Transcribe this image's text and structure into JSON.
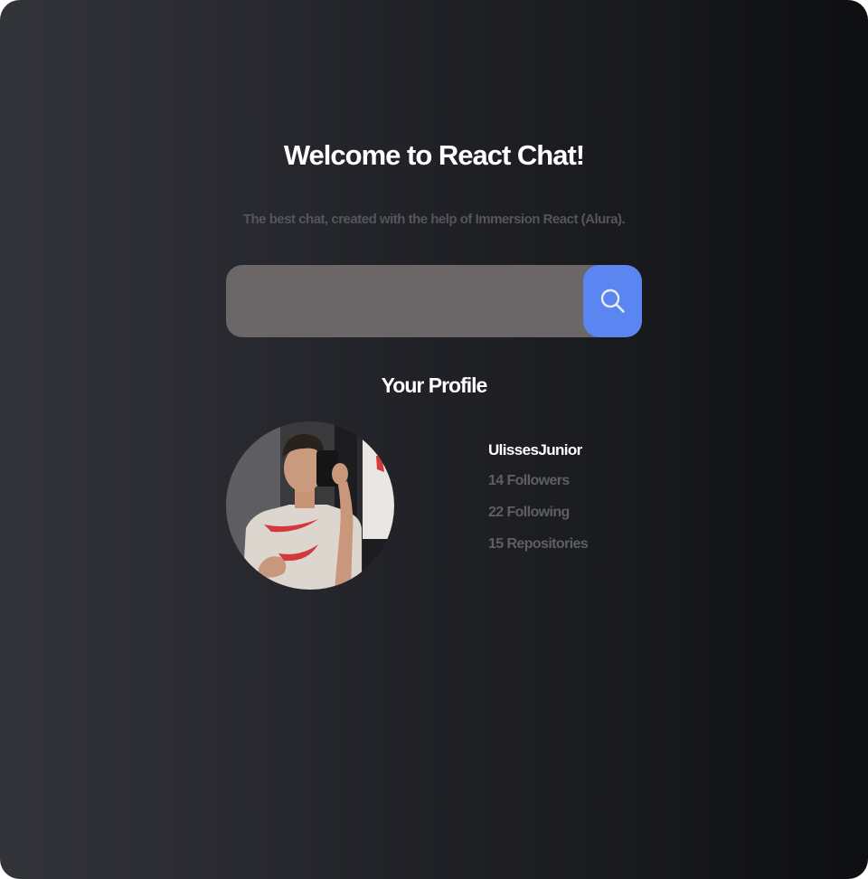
{
  "header": {
    "title": "Welcome to React Chat!",
    "subtitle": "The best chat, created with the help of Immersion React (Alura)."
  },
  "search": {
    "value": "",
    "placeholder": "",
    "button_icon": "search-icon"
  },
  "profile": {
    "heading": "Your Profile",
    "username": "UlissesJunior",
    "followers": "14 Followers",
    "following": "22 Following",
    "repositories": "15 Repositories"
  },
  "colors": {
    "accent": "#5b86f2",
    "input_bg": "#6b6668",
    "muted_text": "#5e5f65"
  }
}
